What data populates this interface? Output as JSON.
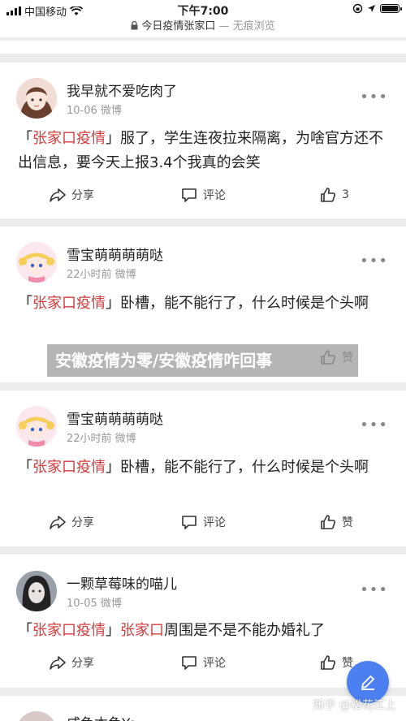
{
  "status_bar": {
    "carrier": "中国移动",
    "time": "下午7:00"
  },
  "url_bar": {
    "title": "今日疫情张家口",
    "suffix": " — 无痕浏览"
  },
  "overlay": {
    "headline": "安徽疫情为零/安徽疫情咋回事"
  },
  "posts": [
    {
      "author": "我早就不爱吃肉了",
      "meta": "10-06 微博",
      "quote_open": "「",
      "keyword": "张家口疫情",
      "quote_close": "」",
      "text": "服了，学生连夜拉来隔离，为啥官方还不出信息，要今天上报3.4个我真的会笑",
      "share": "分享",
      "comment": "评论",
      "like": "3"
    },
    {
      "author": "雪宝萌萌萌萌哒",
      "meta": "22小时前 微博",
      "quote_open": "「",
      "keyword": "张家口疫情",
      "quote_close": "」",
      "text": "卧槽，能不能行了，什么时候是个头啊",
      "share": "分享",
      "comment": "评论",
      "like": "赞"
    },
    {
      "author": "雪宝萌萌萌萌哒",
      "meta": "22小时前 微博",
      "quote_open": "「",
      "keyword": "张家口疫情",
      "quote_close": "」",
      "text": "卧槽，能不能行了，什么时候是个头啊",
      "share": "分享",
      "comment": "评论",
      "like": "赞"
    },
    {
      "author": "一颗草莓味的喵儿",
      "meta": "10-05 微博",
      "quote_open": "「",
      "keyword": "张家口疫情",
      "quote_close": "」",
      "keyword2": "张家口",
      "text": "周围是不是不能办婚礼了",
      "share": "分享",
      "comment": "评论",
      "like": "赞"
    },
    {
      "author": "咸鱼本鱼Yo"
    }
  ],
  "watermark": "知乎 @松花江上"
}
